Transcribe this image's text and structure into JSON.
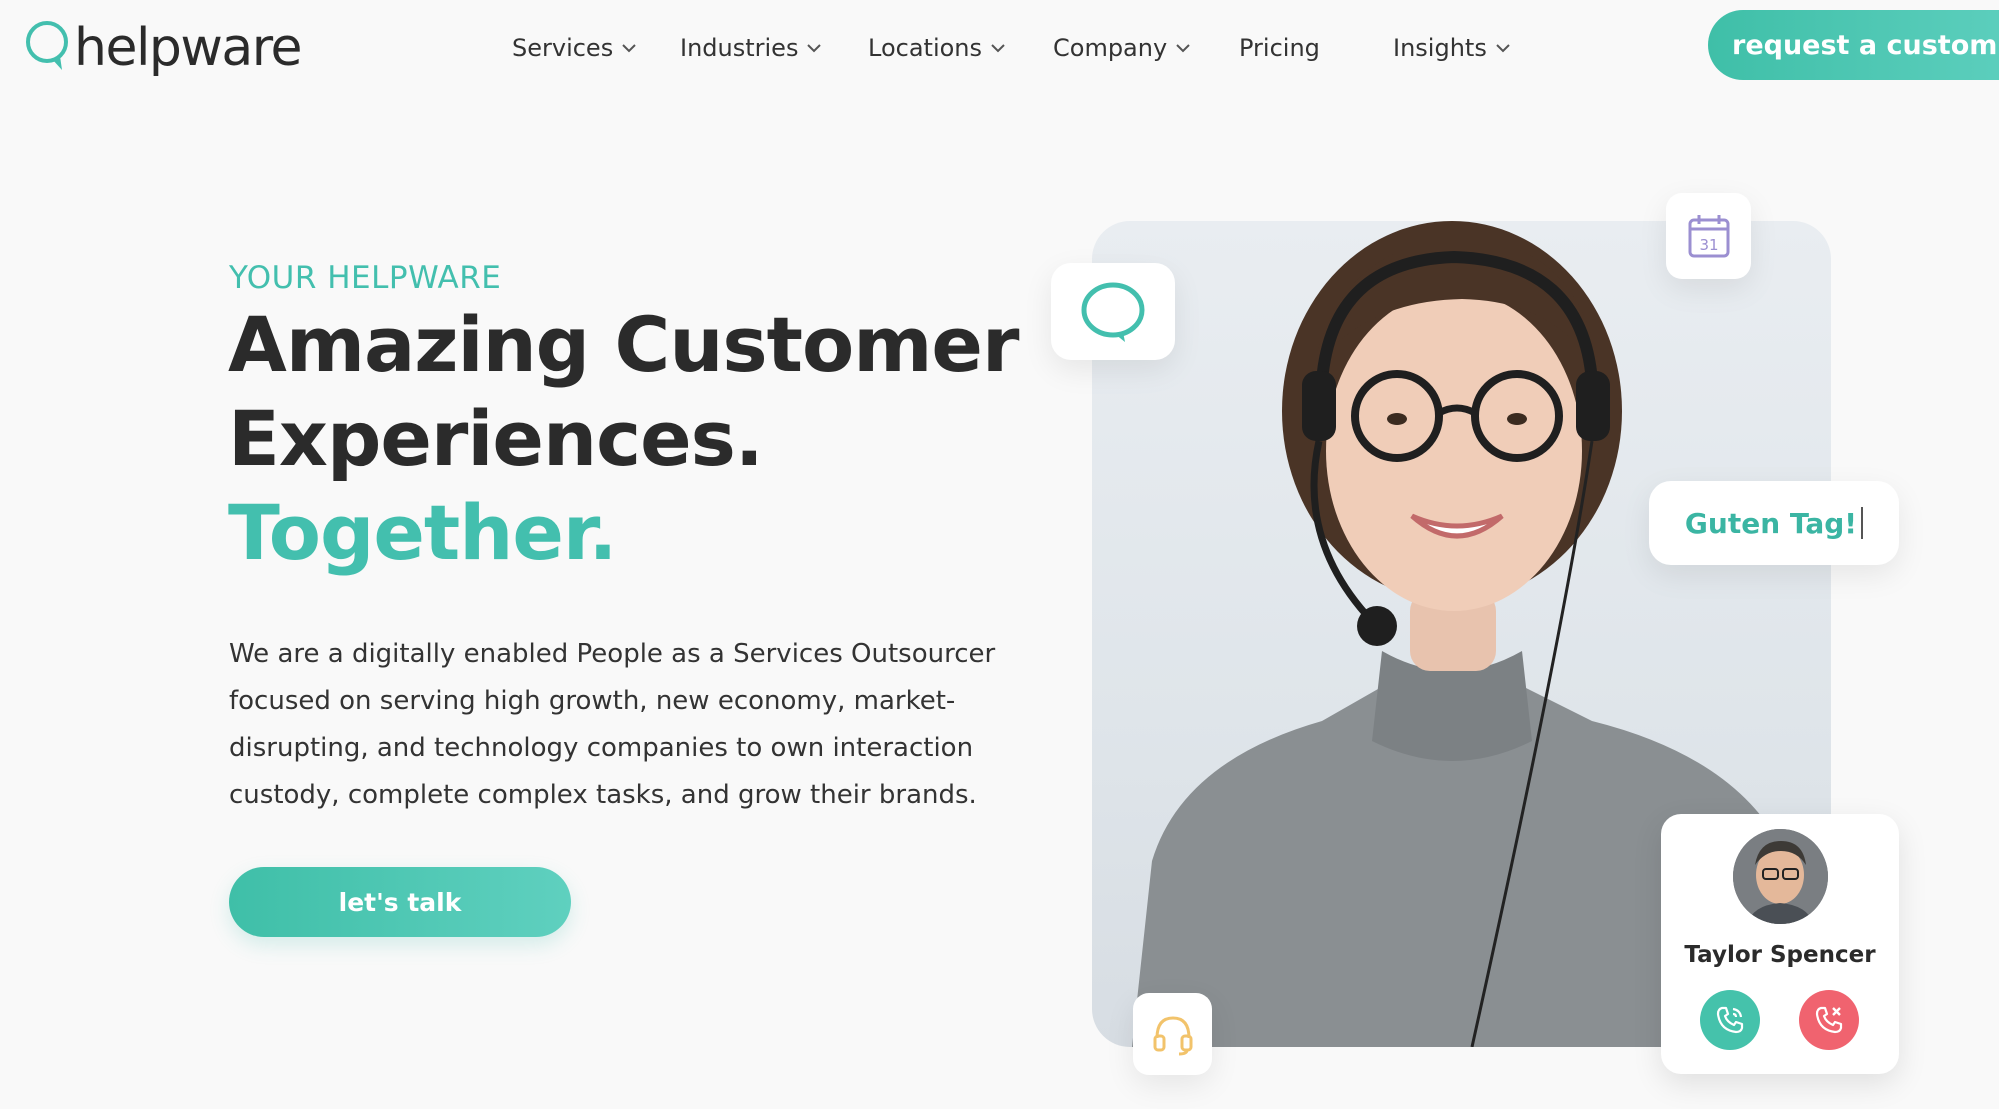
{
  "brand": {
    "name": "helpware",
    "accent": "#43bfae",
    "decline": "#f0636f",
    "icon": "speech-bubble-icon"
  },
  "nav": {
    "items": [
      {
        "label": "Services",
        "has_dropdown": true
      },
      {
        "label": "Industries",
        "has_dropdown": true
      },
      {
        "label": "Locations",
        "has_dropdown": true
      },
      {
        "label": "Company",
        "has_dropdown": true
      },
      {
        "label": "Pricing",
        "has_dropdown": false
      },
      {
        "label": "Insights",
        "has_dropdown": true
      }
    ],
    "cta_label": "request a custom qu"
  },
  "hero": {
    "eyebrow": "YOUR HELPWARE",
    "headline_line1": "Amazing Customer",
    "headline_line2": "Experiences.",
    "headline_line3": "Together.",
    "body": "We are a digitally enabled People as a Services Outsourcer focused on serving high growth, new economy, market-disrupting, and technology companies to own interaction custody, complete complex tasks, and grow their brands.",
    "button_label": "let's talk"
  },
  "visual": {
    "greeting": "Guten Tag!",
    "calendar_day": "31",
    "contact": {
      "name": "Taylor Spencer"
    },
    "icons": [
      "chat-bubble-icon",
      "calendar-icon",
      "headset-icon",
      "phone-accept-icon",
      "phone-decline-icon"
    ]
  }
}
